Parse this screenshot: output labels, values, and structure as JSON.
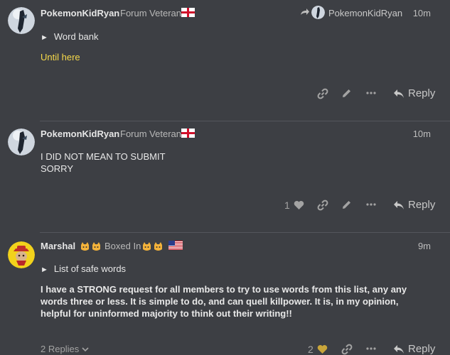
{
  "post1": {
    "username": "PokemonKidRyan",
    "user_title": "Forum Veteran",
    "reply_to_user": "PokemonKidRyan",
    "time": "10m",
    "details_summary": "Word bank",
    "link_text": "Until here",
    "reply_label": "Reply"
  },
  "post2": {
    "username": "PokemonKidRyan",
    "user_title": "Forum Veteran",
    "time": "10m",
    "body_line1": "I DID NOT MEAN TO SUBMIT",
    "body_line2": "SORRY",
    "like_count": "1",
    "reply_label": "Reply"
  },
  "post3": {
    "username": "Marshal",
    "user_title": "Boxed In",
    "time": "9m",
    "details_summary": "List of safe words",
    "body_pre": "I have a ",
    "body_strong": "STRONG",
    "body_post": " request for all members to try to use words from this list, any any words three or less. It is simple to do, and can quell killpower. It is, in my opinion, helpful for uninformed majority to think out their writing!!",
    "replies_label": "2 Replies",
    "like_count": "2",
    "reply_label": "Reply"
  },
  "colors": {
    "background": "#3d3f44",
    "link_yellow": "#f6d94a",
    "heart_gold": "#c9a53a",
    "muted_icon": "#a3a3a3"
  }
}
